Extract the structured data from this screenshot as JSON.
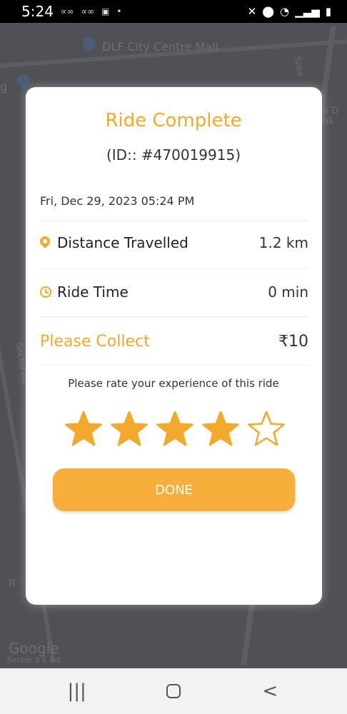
{
  "status_bar": {
    "time": "5:24",
    "left_icons": [
      "notification-icon-1",
      "notification-icon-2",
      "gallery-icon",
      "dot-icon"
    ],
    "right_icons": [
      "mute-icon",
      "location-icon",
      "wifi-icon",
      "signal-icon",
      "battery-icon"
    ]
  },
  "map": {
    "place_label": "DLF City Centre Mall",
    "road_label_left": "Sector Rd",
    "partial_label_top_left": "g",
    "partial_label_right": "Sake",
    "partial_label_right2": "e D\nhk",
    "bottom_label": "Sector 8 E Rd",
    "google_logo": "Google",
    "n_label": "N"
  },
  "modal": {
    "title": "Ride Complete",
    "ride_id": "(ID:: #470019915)",
    "datetime": "Fri, Dec 29, 2023 05:24 PM",
    "distance": {
      "label": "Distance Travelled",
      "value": "1.2 km"
    },
    "ride_time": {
      "label": "Ride Time",
      "value": "0 min"
    },
    "collect": {
      "label": "Please Collect",
      "value": "₹10"
    },
    "rate_prompt": "Please rate your experience of this ride",
    "rating": {
      "filled": 4,
      "max": 5
    },
    "done_label": "DONE"
  },
  "nav_bar": {
    "recents": "recents-icon",
    "home": "home-icon",
    "back": "back-icon"
  },
  "colors": {
    "accent": "#f4a92c",
    "button": "#f8ae3a",
    "text": "#333333",
    "overlay": "#505257"
  }
}
